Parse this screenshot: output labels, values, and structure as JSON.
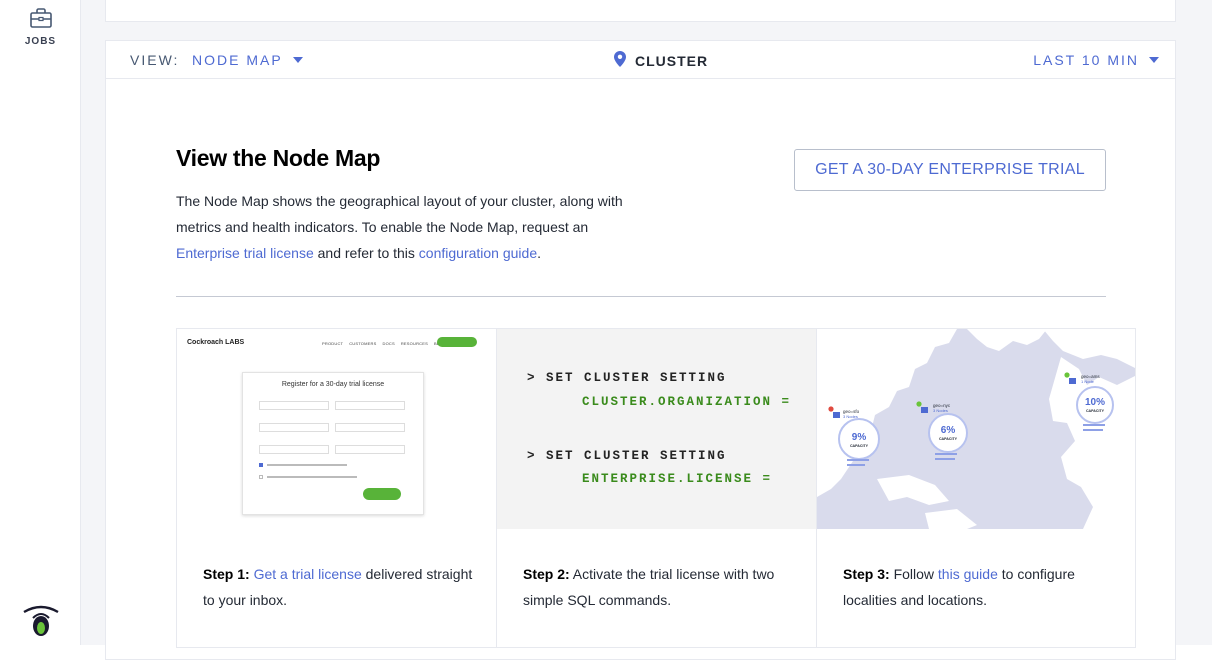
{
  "sidebar": {
    "jobs_label": "JOBS"
  },
  "toolbar": {
    "view_label": "VIEW:",
    "view_value": "NODE MAP",
    "cluster_label": "CLUSTER",
    "time_range": "LAST 10 MIN"
  },
  "intro": {
    "title": "View the Node Map",
    "desc_1": "The Node Map shows the geographical layout of your cluster, along with metrics and health indicators. To enable the Node Map, request an",
    "link_trial": "Enterprise trial license",
    "desc_2": " and refer to this ",
    "link_guide": "configuration guide",
    "desc_3": ".",
    "trial_button": "GET A 30-DAY ENTERPRISE TRIAL"
  },
  "steps": [
    {
      "prefix": "Step 1:",
      "link": "Get a trial license",
      "text": " delivered straight to your inbox.",
      "image": {
        "logo_text": "Cockroach LABS",
        "nav_links": [
          "PRODUCT",
          "CUSTOMERS",
          "DOCS",
          "RESOURCES",
          "BLOG"
        ],
        "form_title": "Register for a 30-day trial license"
      }
    },
    {
      "prefix": "Step 2:",
      "text": " Activate the trial license with two simple SQL commands.",
      "sql": [
        {
          "cmd": "> SET CLUSTER SETTING",
          "arg": "CLUSTER.ORGANIZATION ="
        },
        {
          "cmd": "> SET CLUSTER SETTING",
          "arg": "ENTERPRISE.LICENSE ="
        }
      ]
    },
    {
      "prefix": "Step 3:",
      "pre": " Follow ",
      "link": "this guide",
      "text": " to configure localities and locations.",
      "map": {
        "regions": [
          {
            "name": "geo=sfo",
            "nodes": "3 Nodes",
            "capacity": "9%"
          },
          {
            "name": "geo=nyc",
            "nodes": "3 Nodes",
            "capacity": "6%"
          },
          {
            "name": "geo=ams",
            "nodes": "1 Node",
            "capacity": "10%"
          }
        ],
        "capacity_label": "CAPACITY"
      }
    }
  ],
  "colors": {
    "link": "#4e6ad2",
    "sql_green": "#3a8b1c",
    "cta_green": "#58b339"
  }
}
